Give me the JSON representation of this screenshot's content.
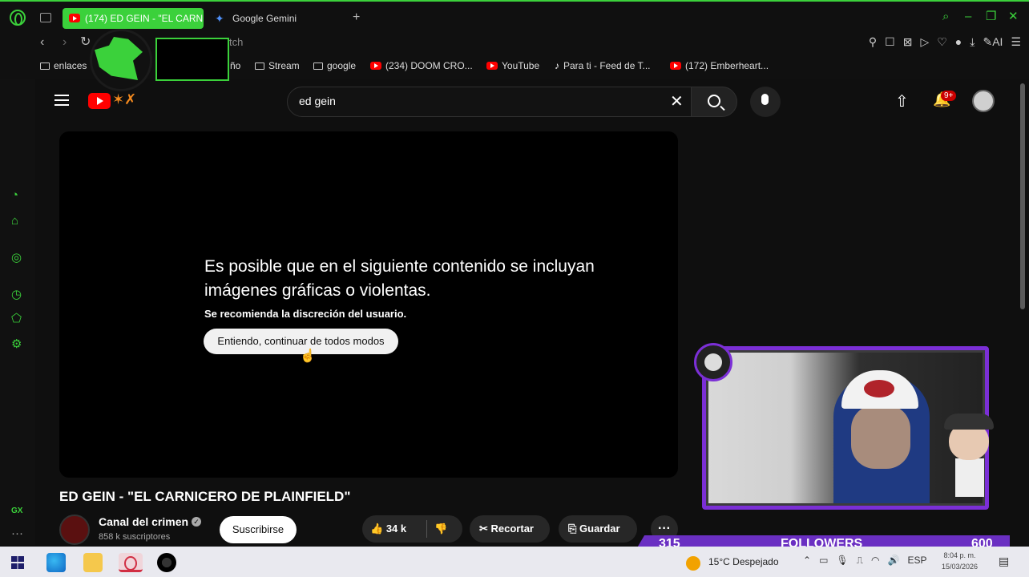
{
  "browser": {
    "tabs": [
      {
        "label": "(174) ED GEIN - \"EL CARNI",
        "active": true
      },
      {
        "label": "Google Gemini",
        "active": false
      }
    ],
    "address_fragment": "tch",
    "bookmarks": [
      {
        "label": "enlaces",
        "icon": "folder-icon"
      },
      {
        "label": "ño",
        "icon": ""
      },
      {
        "label": "Stream",
        "icon": "folder-icon"
      },
      {
        "label": "google",
        "icon": "folder-icon"
      },
      {
        "label": "(234) DOOM CRO...",
        "icon": "youtube-icon"
      },
      {
        "label": "YouTube",
        "icon": "youtube-icon"
      },
      {
        "label": "Para ti - Feed de T...",
        "icon": "tiktok-icon"
      },
      {
        "label": "(172) Emberheart...",
        "icon": "youtube-icon"
      }
    ],
    "accent": "#3bd13b",
    "toolbar_ai": "AI"
  },
  "youtube": {
    "search_query": "ed gein",
    "notification_count": "9+",
    "warning": {
      "title": "Es posible que en el siguiente contenido se incluyan imágenes gráficas o violentas.",
      "subtitle": "Se recomienda la discreción del usuario.",
      "button": "Entiendo, continuar de todos modos"
    },
    "video_title": "ED GEIN - \"EL CARNICERO DE PLAINFIELD\"",
    "channel": {
      "name": "Canal del crimen",
      "subscribers": "858 k suscriptores",
      "subscribe_label": "Suscribirse"
    },
    "actions": {
      "likes": "34 k",
      "clip": "Recortar",
      "save": "Guardar",
      "more": "···"
    }
  },
  "sidebar_gx": "GX",
  "stream_overlay": {
    "followers_current": "315",
    "followers_label": "FOLLOWERS",
    "followers_goal": "600",
    "accent": "#7b2fd6"
  },
  "taskbar": {
    "weather": "15°C  Despejado",
    "language": "ESP",
    "time": "8:04 p. m.",
    "date": "15/03/2026"
  }
}
